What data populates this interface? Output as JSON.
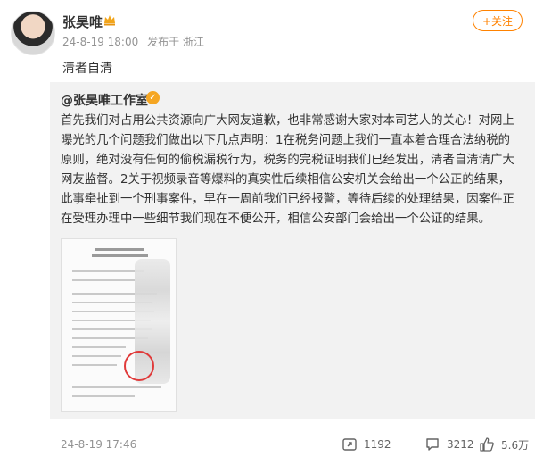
{
  "post": {
    "author": "张昊唯",
    "date": "24-8-19 18:00",
    "source": "发布于 浙江",
    "follow_label": "+关注",
    "text": "清者自清"
  },
  "repost": {
    "author": "@张昊唯工作室",
    "body": "首先我们对占用公共资源向广大网友道歉，也非常感谢大家对本司艺人的关心！对网上曝光的几个问题我们做出以下几点声明：1在税务问题上我们一直本着合理合法纳税的原则，绝对没有任何的偷税漏税行为，税务的完税证明我们已经发出，清者自清请广大网友监督。2关于视频录音等爆料的真实性后续相信公安机关会给出一个公正的结果，此事牵扯到一个刑事案件，早在一周前我们已经报警，等待后续的处理结果，因案件正在受理办理中一些细节我们现在不便公开，相信公安部门会给出一个公证的结果。",
    "time": "24-8-19 17:46",
    "repost_count": "1192",
    "comment_count": "3212",
    "like_count": "5.6万"
  },
  "icons": {
    "crown": "crown-icon",
    "verified": "verified-badge-icon",
    "repost": "repost-icon",
    "comment": "comment-icon",
    "like": "like-icon"
  },
  "colors": {
    "accent": "#ff8200",
    "repost_bg": "#f2f2f2",
    "meta_text": "#939393"
  }
}
